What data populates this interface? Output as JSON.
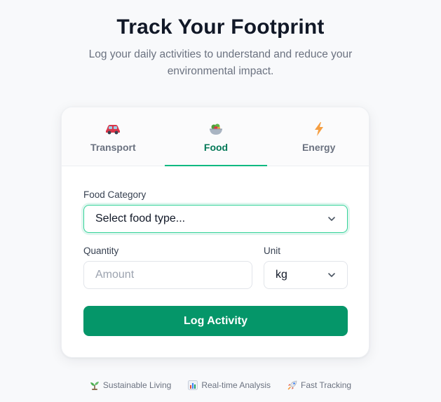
{
  "header": {
    "title": "Track Your Footprint",
    "subtitle": "Log your daily activities to understand and reduce your environmental impact."
  },
  "tabs": [
    {
      "label": "Transport",
      "icon": "car-icon",
      "active": false
    },
    {
      "label": "Food",
      "icon": "salad-bowl-icon",
      "active": true
    },
    {
      "label": "Energy",
      "icon": "lightning-icon",
      "active": false
    }
  ],
  "form": {
    "food_category_label": "Food Category",
    "food_category_value": "Select food type...",
    "quantity_label": "Quantity",
    "quantity_placeholder": "Amount",
    "unit_label": "Unit",
    "unit_value": "kg",
    "submit_label": "Log Activity"
  },
  "features": [
    {
      "label": "Sustainable Living",
      "icon": "seedling-icon"
    },
    {
      "label": "Real-time Analysis",
      "icon": "bar-chart-icon"
    },
    {
      "label": "Fast Tracking",
      "icon": "rocket-icon"
    }
  ],
  "colors": {
    "accent": "#059669",
    "accent_text": "#047857",
    "focus_ring": "#34d399"
  }
}
